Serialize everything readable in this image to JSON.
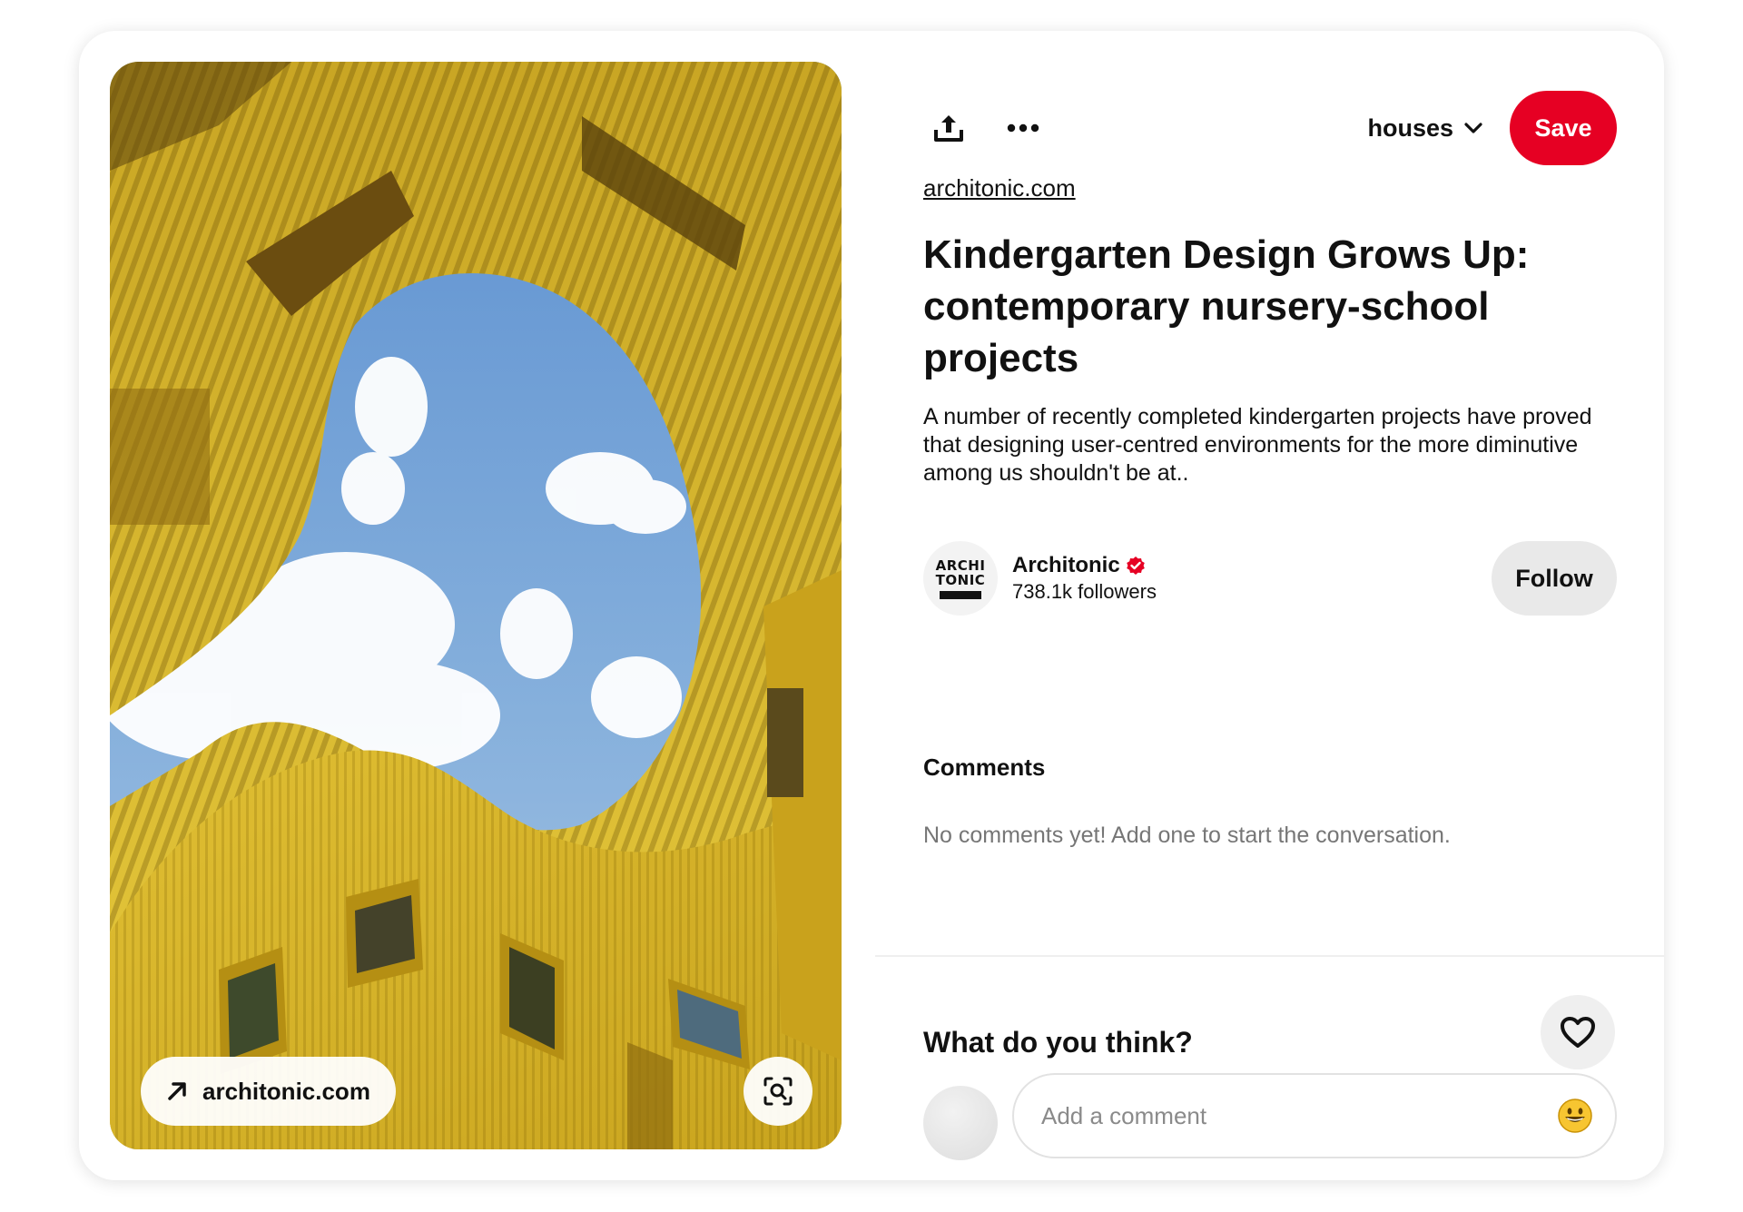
{
  "image": {
    "source_button_label": "architonic.com",
    "lens_icon": "visual-search-icon"
  },
  "toolbar": {
    "share_icon": "share-icon",
    "more_icon": "more-icon",
    "board_name": "houses",
    "board_chevron_icon": "chevron-down-icon",
    "save_label": "Save"
  },
  "pin": {
    "source_link": "architonic.com",
    "title": "Kindergarten Design Grows Up: contemporary nursery-school projects",
    "description": "A number of recently completed kindergarten projects have proved that designing user-centred environments for the more diminutive among us shouldn't be at.."
  },
  "creator": {
    "avatar_line1": "ARCHI",
    "avatar_line2": "TONIC",
    "name": "Architonic",
    "verified_icon": "verified-badge-icon",
    "followers": "738.1k followers",
    "follow_label": "Follow"
  },
  "comments": {
    "heading": "Comments",
    "empty_text": "No comments yet! Add one to start the conversation."
  },
  "reply": {
    "prompt": "What do you think?",
    "heart_icon": "heart-icon",
    "placeholder": "Add a comment",
    "emoji_icon": "smiley-emoji-icon"
  },
  "colors": {
    "save": "#e60023",
    "verified": "#e60023",
    "follow_bg": "#e9e9e9",
    "muted_text": "#767676"
  }
}
